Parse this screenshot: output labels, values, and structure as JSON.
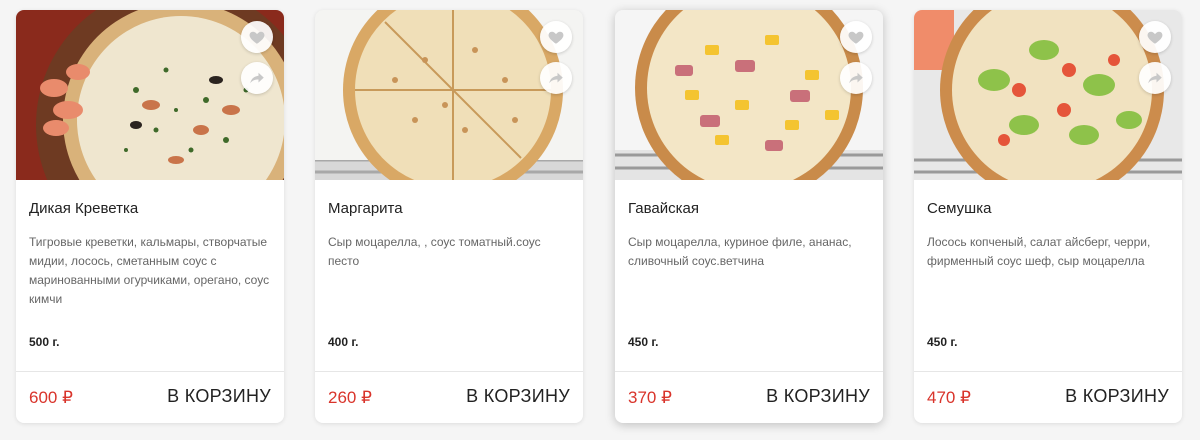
{
  "products": [
    {
      "name": "Дикая Креветка",
      "description": "Тигровые креветки, кальмары, створчатые мидии, лосось, сметанным соус с маринованными огурчиками, орегано, соус кимчи",
      "weight": "500 г.",
      "price": "600 ₽",
      "cart_label": "В КОРЗИНУ"
    },
    {
      "name": "Маргарита",
      "description": "Сыр моцарелла, , соус томатный.соус песто",
      "weight": "400 г.",
      "price": "260 ₽",
      "cart_label": "В КОРЗИНУ"
    },
    {
      "name": "Гавайская",
      "description": "Сыр моцарелла, куриное филе, ананас, сливочный соус.ветчина",
      "weight": "450 г.",
      "price": "370 ₽",
      "cart_label": "В КОРЗИНУ"
    },
    {
      "name": "Семушка",
      "description": "Лосось копченый, салат айсберг, черри, фирменный соус шеф, сыр моцарелла",
      "weight": "450 г.",
      "price": "470 ₽",
      "cart_label": "В КОРЗИНУ"
    }
  ],
  "icons": {
    "favorite": "heart-icon",
    "share": "share-arrow-icon"
  },
  "colors": {
    "price": "#d9342b",
    "icon_gray": "#c8c8c8"
  }
}
